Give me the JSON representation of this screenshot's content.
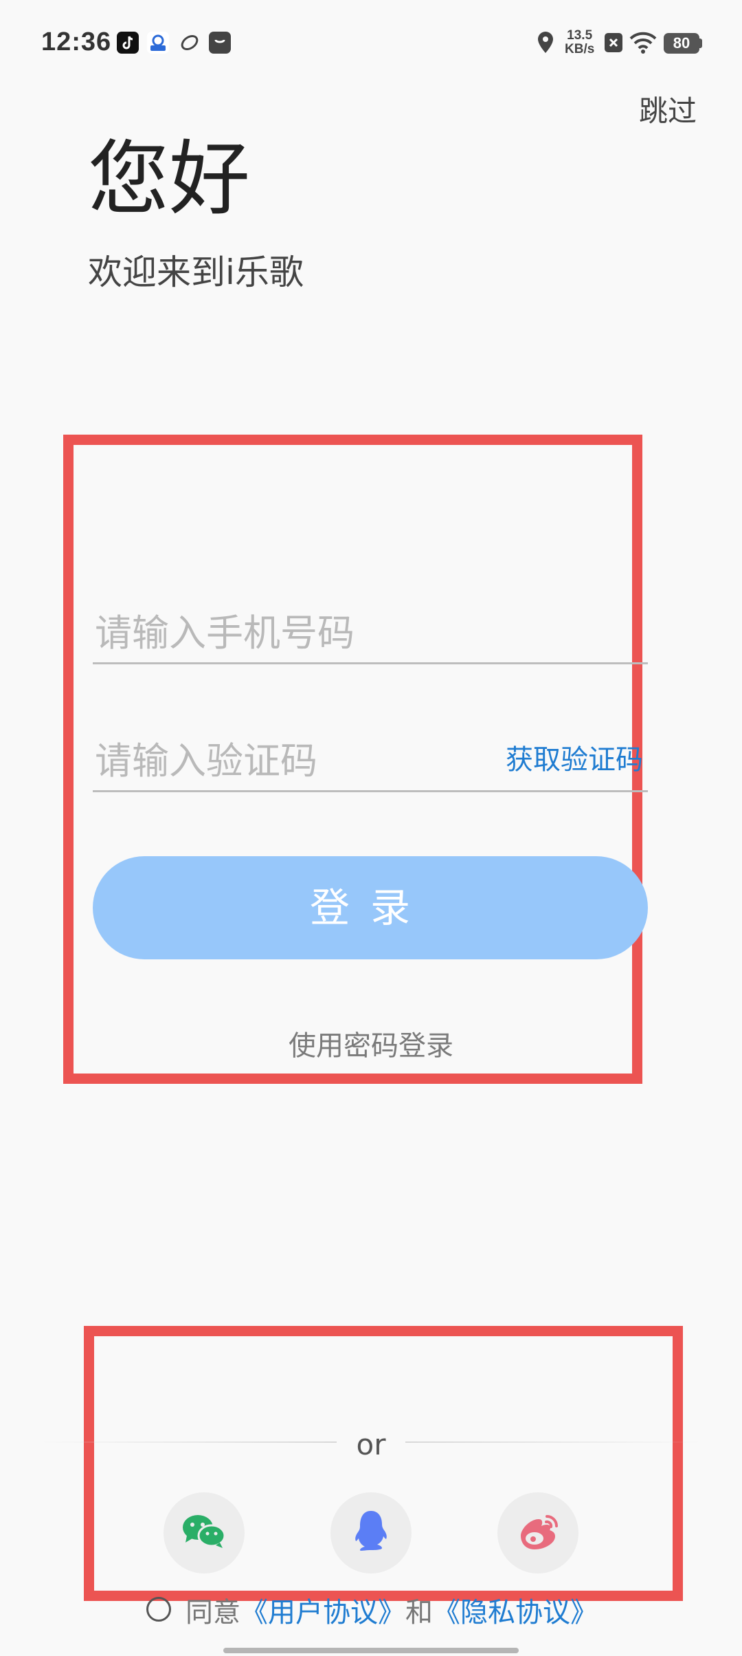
{
  "status_bar": {
    "time": "12:36",
    "net_speed_value": "13.5",
    "net_speed_unit": "KB/s",
    "battery": "80"
  },
  "header": {
    "skip_label": "跳过",
    "title": "您好",
    "subtitle": "欢迎来到i乐歌"
  },
  "form": {
    "phone_placeholder": "请输入手机号码",
    "code_placeholder": "请输入验证码",
    "get_code_label": "获取验证码",
    "login_label": "登录",
    "password_login_label": "使用密码登录"
  },
  "social": {
    "divider_label": "or",
    "icons": [
      "wechat-icon",
      "qq-icon",
      "weibo-icon"
    ]
  },
  "agreement": {
    "agree_label": "同意",
    "user_agreement": "《用户协议》",
    "and_label": "和",
    "privacy_policy": "《隐私协议》"
  },
  "colors": {
    "accent_blue": "#1f7cd1",
    "login_button": "#97c7fa",
    "annotation_red": "#ec5452",
    "wechat_green": "#2aae67",
    "qq_blue": "#5b7ef5",
    "weibo_pink": "#e86b7d"
  }
}
